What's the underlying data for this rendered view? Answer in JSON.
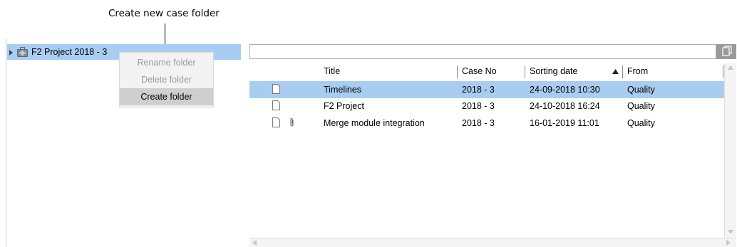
{
  "callout": {
    "text": "Create new case folder"
  },
  "tree": {
    "node_label": "F2 Project 2018 - 3",
    "node_icon": "case-folder-icon",
    "expand_icon": "expand-arrow-icon"
  },
  "context_menu": {
    "items": [
      {
        "label": "Rename folder",
        "enabled": false
      },
      {
        "label": "Delete folder",
        "enabled": false
      },
      {
        "label": "Create folder",
        "enabled": true,
        "highlighted": true
      }
    ]
  },
  "search": {
    "value": "",
    "button_icon": "copy-icon"
  },
  "table": {
    "columns": [
      {
        "label": "Title"
      },
      {
        "label": "Case No"
      },
      {
        "label": "Sorting date",
        "sort": "ascending",
        "sort_icon": "sort-up-icon"
      },
      {
        "label": "From"
      }
    ],
    "rows": [
      {
        "title": "Timelines",
        "case_no": "2018 - 3",
        "sorting_date": "24-09-2018 10:30",
        "from": "Quality",
        "selected": true,
        "attachment": false,
        "icon": "document-icon"
      },
      {
        "title": "F2 Project",
        "case_no": "2018 - 3",
        "sorting_date": "24-10-2018 16:24",
        "from": "Quality",
        "selected": false,
        "attachment": false,
        "icon": "document-icon"
      },
      {
        "title": "Merge module integration",
        "case_no": "2018 - 3",
        "sorting_date": "16-01-2019 11:01",
        "from": "Quality",
        "selected": false,
        "attachment": true,
        "icon": "document-icon"
      }
    ]
  },
  "colors": {
    "selection": "#a9cdf1",
    "menu_highlight": "#cfcfcf",
    "disabled_text": "#9a9a9a"
  }
}
